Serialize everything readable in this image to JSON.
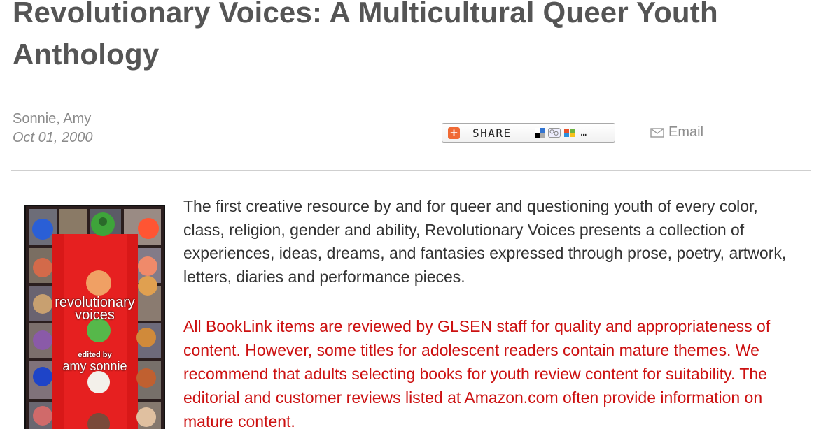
{
  "article": {
    "title": "Revolutionary Voices: A Multicultural Queer Youth Anthology",
    "author": "Sonnie, Amy",
    "date": "Oct 01, 2000"
  },
  "share_bar": {
    "share_label": "SHARE",
    "more_label": "…",
    "email_label": "Email",
    "icons": [
      "share-plus-icon",
      "delicious-icon",
      "digg-icon",
      "yahoo-icon"
    ]
  },
  "book_cover": {
    "title_line1": "revolutionary",
    "title_line2": "voices",
    "edited_by": "edited by",
    "editor": "amy sonnie"
  },
  "content": {
    "description": "The first creative resource by and for queer and questioning youth of every color, class, religion, gender and ability, Revolutionary Voices presents a collection of experiences, ideas, dreams, and fantasies expressed through prose, poetry, artwork, letters, diaries and performance pieces.",
    "notice": "All BookLink items are reviewed by GLSEN staff for quality and appropriateness of content. However, some titles for adolescent readers contain mature themes. We recommend that adults selecting books for youth review content for suitability. The editorial and customer reviews listed at Amazon.com often provide information on mature content."
  },
  "colors": {
    "title": "#555555",
    "byline": "#8a8a8a",
    "body_text": "#333333",
    "notice_text": "#cc1111",
    "share_accent": "#f06a35",
    "cover_red": "#d81818"
  }
}
